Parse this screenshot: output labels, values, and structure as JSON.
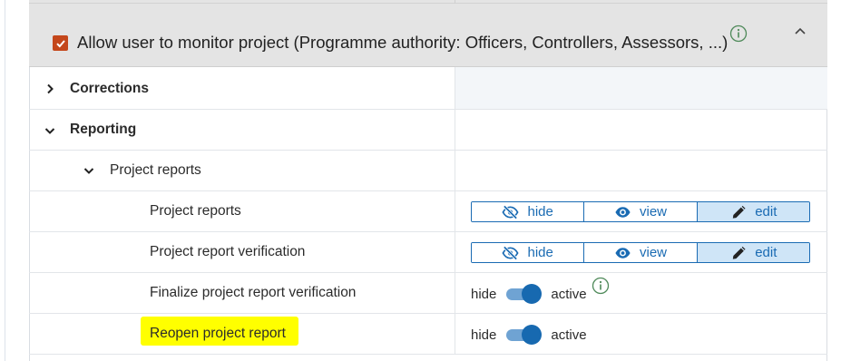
{
  "header": {
    "checkbox_checked": true,
    "label": "Allow user to monitor project (Programme authority: Officers, Controllers, Assessors, ...)"
  },
  "rows": {
    "corrections": {
      "label": "Corrections"
    },
    "reporting": {
      "label": "Reporting"
    },
    "project_reports_group": {
      "label": "Project reports"
    },
    "project_reports": {
      "label": "Project reports"
    },
    "project_report_verification": {
      "label": "Project report verification"
    },
    "finalize_verification": {
      "label": "Finalize project report verification"
    },
    "reopen_project_report": {
      "label": "Reopen project report"
    }
  },
  "segmented": {
    "hide": "hide",
    "view": "view",
    "edit": "edit",
    "selected": "edit"
  },
  "toggle": {
    "off_label": "hide",
    "on_label": "active",
    "finalize_state": "active",
    "reopen_state": "active"
  },
  "colors": {
    "accent": "#1a6bb3",
    "checkbox": "#c4471b",
    "highlight": "#ffff00",
    "selected_segment": "#cfe5f7"
  },
  "icons": {
    "expand": "chevron-right-icon",
    "collapse": "chevron-down-icon",
    "panel_collapse": "chevron-up-icon",
    "info": "info-circle-icon",
    "hide": "eye-slash-icon",
    "view": "eye-icon",
    "edit": "pencil-icon"
  }
}
